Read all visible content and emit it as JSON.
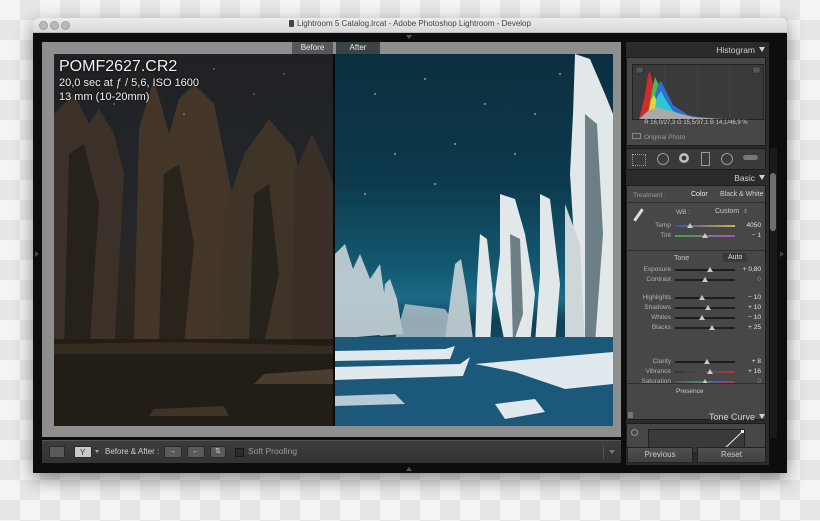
{
  "window": {
    "title": "Lightroom 5 Catalog.lrcat - Adobe Photoshop Lightroom - Develop"
  },
  "viewer": {
    "before_tab": "Before",
    "after_tab": "After",
    "info": {
      "filename": "POMF2627.CR2",
      "exposure": "20,0 sec at ƒ / 5,6, ISO 1600",
      "lens": "13 mm (10-20mm)"
    }
  },
  "toolbar": {
    "before_after_label": "Before & After :",
    "soft_proofing_label": "Soft Proofing",
    "soft_proofing_checked": false
  },
  "histogram": {
    "header": "Histogram",
    "readout": "R  16,0/27,3   G  15,5/37,1   B  14,1/46,9  %",
    "r": "16,0/27,3",
    "g": "15,5/37,1",
    "b": "14,1/46,9",
    "original_photo_label": "Original Photo"
  },
  "basic": {
    "header": "Basic",
    "treatment_label": "Treatment :",
    "treatment_color": "Color",
    "treatment_bw": "Black & White",
    "wb_label": "WB :",
    "wb_value": "Custom",
    "tone_label": "Tone",
    "auto_label": "Auto",
    "presence_label": "Presence",
    "sliders": [
      {
        "label": "Temp",
        "value": "4050",
        "position": 0.25,
        "group": "wb"
      },
      {
        "label": "Tint",
        "value": "− 1",
        "position": 0.5,
        "group": "wb"
      },
      {
        "label": "Exposure",
        "value": "+ 0,80",
        "position": 0.58,
        "group": "tone"
      },
      {
        "label": "Contrast",
        "value": "0",
        "position": 0.5,
        "group": "tone"
      },
      {
        "label": "Highlights",
        "value": "− 10",
        "position": 0.45,
        "group": "tone2"
      },
      {
        "label": "Shadows",
        "value": "+ 10",
        "position": 0.55,
        "group": "tone2"
      },
      {
        "label": "Whites",
        "value": "− 10",
        "position": 0.45,
        "group": "tone2"
      },
      {
        "label": "Blacks",
        "value": "+ 25",
        "position": 0.62,
        "group": "tone2"
      },
      {
        "label": "Clarity",
        "value": "+ 8",
        "position": 0.54,
        "group": "presence"
      },
      {
        "label": "Vibrance",
        "value": "+ 16",
        "position": 0.58,
        "group": "presence"
      },
      {
        "label": "Saturation",
        "value": "0",
        "position": 0.5,
        "group": "presence"
      }
    ]
  },
  "tone_curve": {
    "header": "Tone Curve"
  },
  "buttons": {
    "previous": "Previous",
    "reset": "Reset"
  }
}
